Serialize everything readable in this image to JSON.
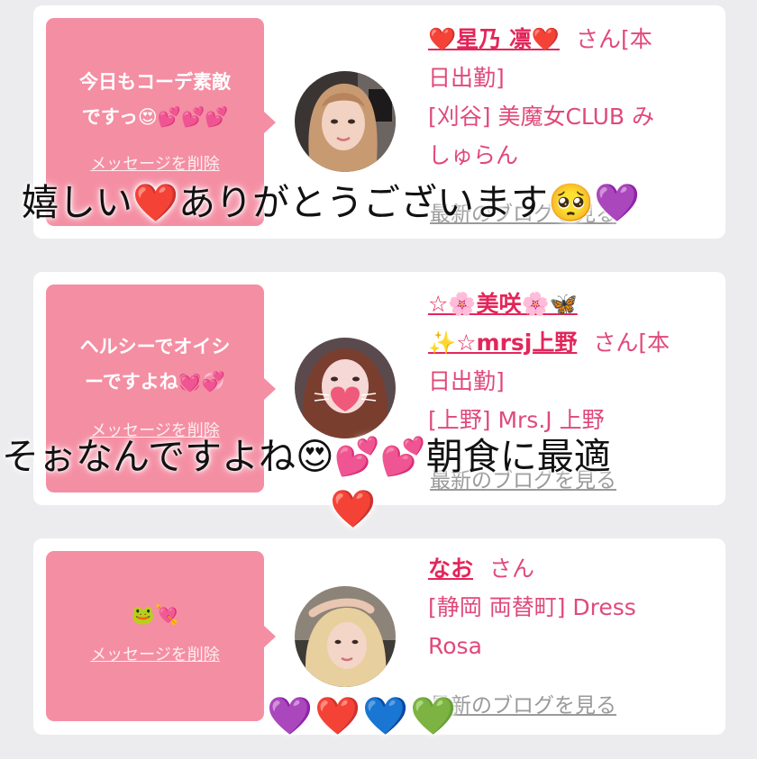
{
  "cards": [
    {
      "message_line1": "今日もコーデ素敵",
      "message_line2": "ですっ😍💕💕💕",
      "delete_label": "メッセージを削除",
      "name": "❤️星乃 凛❤️",
      "honorific": "さん[本",
      "line2": "日出勤]",
      "line3": "[刈谷] 美魔女CLUB み",
      "line4": "しゅらん",
      "blog_label": "最新のブログを見る"
    },
    {
      "message_line1": "ヘルシーでオイシ",
      "message_line2": "ーですよね💓💞",
      "delete_label": "メッセージを削除",
      "name_line1": "☆🌸美咲🌸🦋",
      "name_line2": "✨☆mrsj上野",
      "honorific": "さん[本",
      "line2": "日出勤]",
      "line3": "[上野] Mrs.J 上野",
      "blog_label": "最新のブログを見る"
    },
    {
      "message_line1": "🐸💘",
      "delete_label": "メッセージを削除",
      "name": "なお",
      "honorific": "さん",
      "line2": "[静岡 両替町] Dress",
      "line3": "Rosa",
      "blog_label": "最新のブログを見る"
    }
  ],
  "overlays": {
    "caption1": "嬉しい❤️ありがとうございます🥺💜",
    "caption2": "そぉなんですよね😍💕💕朝食に最適",
    "caption2_heart": "❤️",
    "hearts_row": "💜❤️💙💚"
  },
  "colors": {
    "bubble": "#f48ea3",
    "name": "#e3265a",
    "info": "#e0497a",
    "background": "#ececee"
  }
}
